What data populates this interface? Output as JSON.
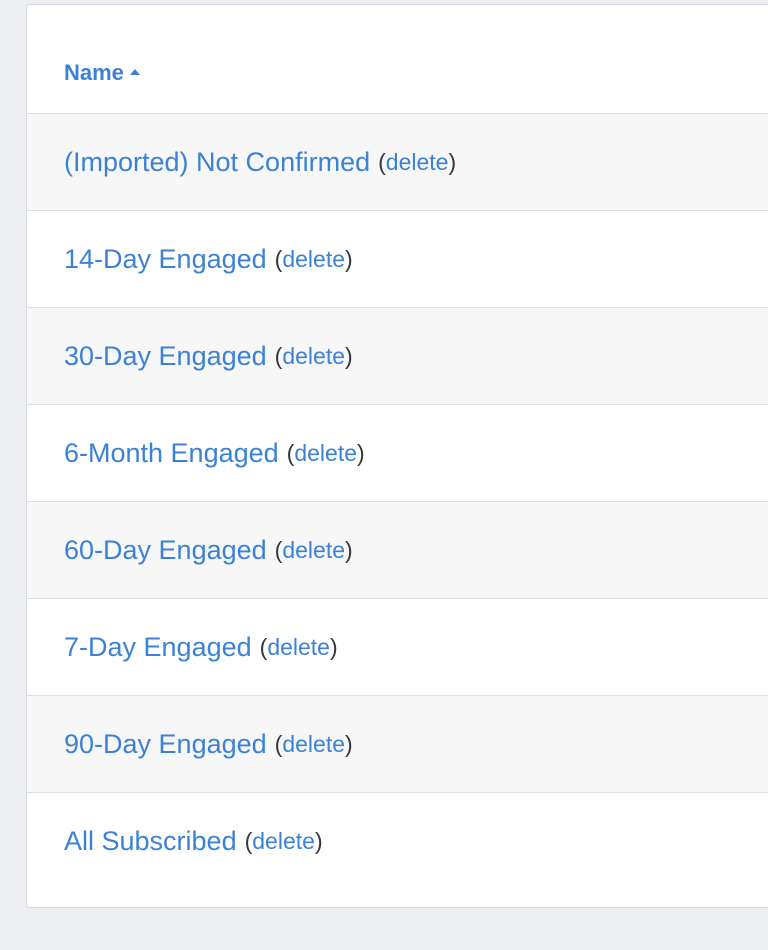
{
  "table": {
    "column_header": "Name",
    "sort_direction": "ascending",
    "rows": [
      {
        "name": "(Imported) Not Confirmed",
        "delete_label": "delete"
      },
      {
        "name": "14-Day Engaged",
        "delete_label": "delete"
      },
      {
        "name": "30-Day Engaged",
        "delete_label": "delete"
      },
      {
        "name": "6-Month Engaged",
        "delete_label": "delete"
      },
      {
        "name": "60-Day Engaged",
        "delete_label": "delete"
      },
      {
        "name": "7-Day Engaged",
        "delete_label": "delete"
      },
      {
        "name": "90-Day Engaged",
        "delete_label": "delete"
      },
      {
        "name": "All Subscribed",
        "delete_label": "delete"
      }
    ],
    "paren_open": "(",
    "paren_close": ")"
  },
  "colors": {
    "link": "#3b82d6",
    "stripe": "#f7f7f8",
    "background": "#eceef1"
  }
}
